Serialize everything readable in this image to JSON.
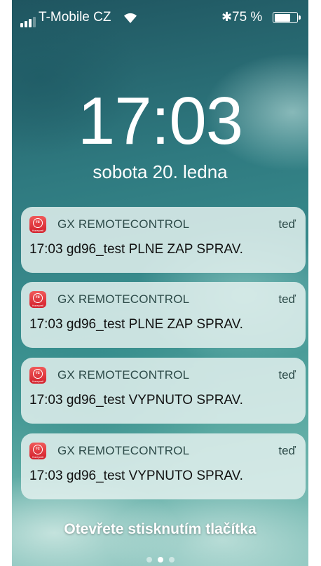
{
  "status_bar": {
    "carrier": "T-Mobile CZ",
    "signal_bars": 3,
    "wifi_icon": "wifi-icon",
    "bluetooth_icon": "bluetooth-icon",
    "bluetooth_glyph": "✱",
    "battery_text": "75 %",
    "battery_level": 0.75
  },
  "lock_screen": {
    "time": "17:03",
    "date": "sobota 20. ledna",
    "unlock_hint": "Otevřete stisknutím tlačítka",
    "page_count": 3,
    "active_page": 1
  },
  "notifications": [
    {
      "app_name": "GX REMOTECONTROL",
      "time": "teď",
      "message": "17:03 gd96_test PLNE ZAP  SPRAV."
    },
    {
      "app_name": "GX REMOTECONTROL",
      "time": "teď",
      "message": "17:03 gd96_test PLNE ZAP  SPRAV."
    },
    {
      "app_name": "GX REMOTECONTROL",
      "time": "teď",
      "message": "17:03 gd96_test VYPNUTO   SPRAV."
    },
    {
      "app_name": "GX REMOTECONTROL",
      "time": "teď",
      "message": "17:03 gd96_test VYPNUTO   SPRAV."
    }
  ],
  "app_icon": {
    "name": "gx-remotecontrol-app-icon",
    "ring_text": "rc",
    "brand_text": "Honeywell",
    "color": "#e0303a"
  },
  "colors": {
    "notification_bg": "#e2f0ee",
    "text_light": "#ffffff"
  }
}
